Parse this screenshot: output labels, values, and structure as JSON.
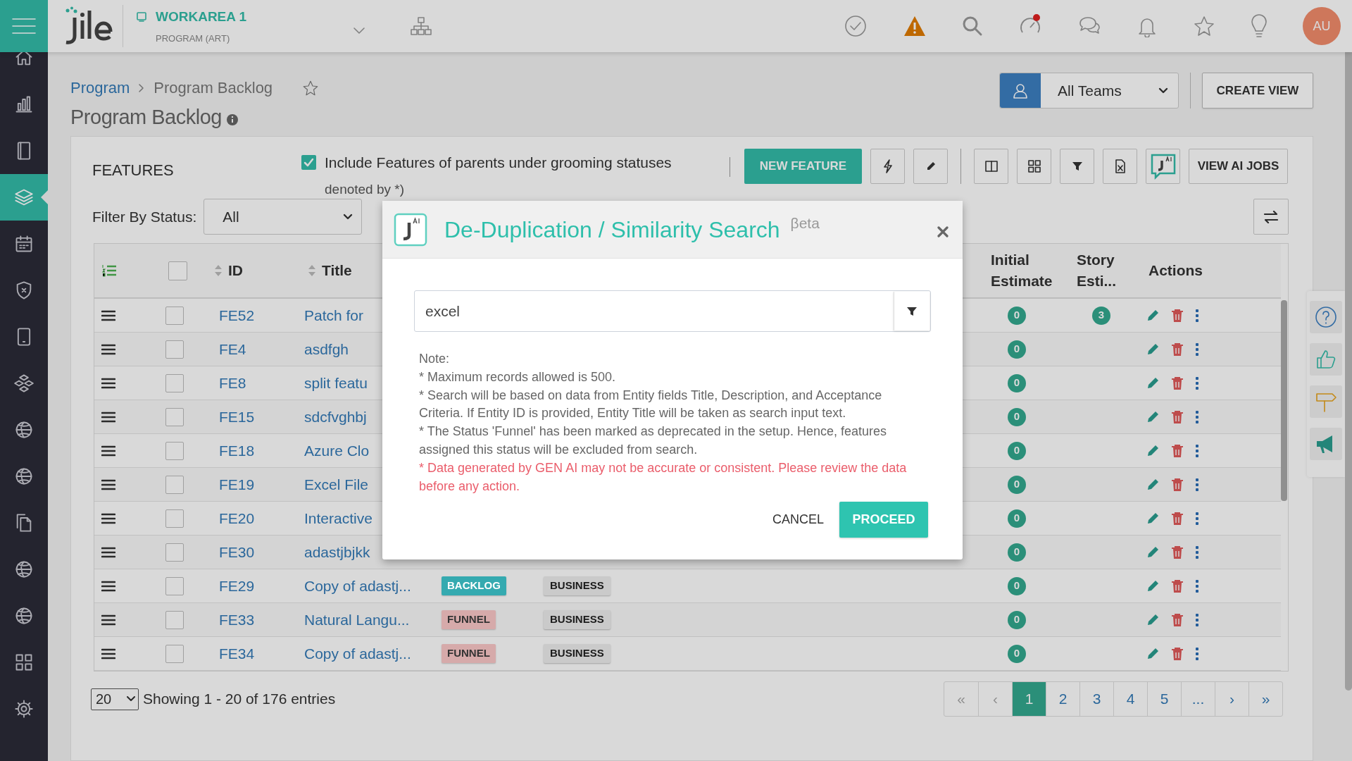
{
  "header": {
    "workarea": "WORKAREA 1",
    "subtitle": "PROGRAM (ART)",
    "avatar": "AU"
  },
  "sidebar": {
    "items": [
      {
        "kind": "home",
        "selected": false
      },
      {
        "kind": "chart",
        "selected": false
      },
      {
        "kind": "notebook",
        "selected": false
      },
      {
        "kind": "layers",
        "selected": true
      },
      {
        "kind": "calendar",
        "selected": false
      },
      {
        "kind": "shield",
        "selected": false
      },
      {
        "kind": "tablet",
        "selected": false
      },
      {
        "kind": "cubes",
        "selected": false
      },
      {
        "kind": "ball",
        "selected": false
      },
      {
        "kind": "ball",
        "selected": false
      },
      {
        "kind": "docs",
        "selected": false
      },
      {
        "kind": "ball",
        "selected": false
      },
      {
        "kind": "ball",
        "selected": false
      },
      {
        "kind": "grid",
        "selected": false
      },
      {
        "kind": "gear",
        "selected": false
      }
    ]
  },
  "breadcrumb": [
    "Program",
    "Program Backlog"
  ],
  "page_title": "Program Backlog",
  "team_select": "All Teams",
  "create_view": "CREATE VIEW",
  "features": {
    "title": "FEATURES",
    "include_parents": {
      "label": "Include Features of parents under grooming statuses",
      "checked": true
    },
    "note": "denoted by *)",
    "new_button": "NEW FEATURE",
    "ai_jobs_button": "VIEW AI JOBS",
    "filter_label": "Filter By Status:",
    "filter_value": "All"
  },
  "table": {
    "select_all_checked": false,
    "columns": [
      "ID",
      "Title",
      "Initial Estimate",
      "Story Esti...",
      "Actions"
    ],
    "rows": [
      {
        "id": "FE52",
        "title": "Patch for",
        "initial": "0",
        "story": "3",
        "checked": false
      },
      {
        "id": "FE4",
        "title": "asdfgh",
        "initial": "0",
        "checked": false
      },
      {
        "id": "FE8",
        "title": "split featu",
        "initial": "0",
        "checked": false
      },
      {
        "id": "FE15",
        "title": "sdcfvghbj",
        "initial": "0",
        "checked": false
      },
      {
        "id": "FE18",
        "title": "Azure Clo",
        "initial": "0",
        "checked": false
      },
      {
        "id": "FE19",
        "title": "Excel File",
        "initial": "0",
        "checked": false
      },
      {
        "id": "FE20",
        "title": "Interactive",
        "initial": "0",
        "checked": false
      },
      {
        "id": "FE30",
        "title": "adastjbjkk",
        "initial": "0",
        "checked": false
      },
      {
        "id": "FE29",
        "title": "Copy of adastj...",
        "status": {
          "label": "BACKLOG",
          "color": "#35aab0"
        },
        "type": "BUSINESS",
        "initial": "0",
        "checked": false
      },
      {
        "id": "FE33",
        "title": "Natural Langu...",
        "status": {
          "label": "FUNNEL",
          "color": "#d6aaaa"
        },
        "type": "BUSINESS",
        "initial": "0",
        "checked": false
      },
      {
        "id": "FE34",
        "title": "Copy of adastj...",
        "status": {
          "label": "FUNNEL",
          "color": "#d6aaaa"
        },
        "type": "BUSINESS",
        "initial": "0",
        "checked": false
      }
    ]
  },
  "pagination": {
    "page_size": "20",
    "summary": "Showing 1 - 20 of 176 entries",
    "pages": [
      {
        "label": "«",
        "selected": false,
        "disabled": true
      },
      {
        "label": "‹",
        "selected": false,
        "disabled": true
      },
      {
        "label": "1",
        "selected": true,
        "disabled": false
      },
      {
        "label": "2",
        "selected": false,
        "disabled": false
      },
      {
        "label": "3",
        "selected": false,
        "disabled": false
      },
      {
        "label": "4",
        "selected": false,
        "disabled": false
      },
      {
        "label": "5",
        "selected": false,
        "disabled": false
      },
      {
        "label": "...",
        "selected": false,
        "disabled": false
      },
      {
        "label": "›",
        "selected": false,
        "disabled": false
      },
      {
        "label": "»",
        "selected": false,
        "disabled": false
      }
    ]
  },
  "modal": {
    "title": "De-Duplication / Similarity Search",
    "badge": "βeta",
    "search_value": "excel",
    "notes": [
      "Note:",
      "* Maximum records allowed is 500.",
      "* Search will be based on data from Entity fields Title, Description, and Acceptance Criteria. If Entity ID is provided, Entity Title will be taken as search input text.",
      "* The Status 'Funnel' has been marked as deprecated in the setup. Hence, features assigned this status will be excluded from search."
    ],
    "warning": "* Data generated by GEN AI may not be accurate or consistent. Please review the data before any action.",
    "cancel": "CANCEL",
    "proceed": "PROCEED"
  }
}
